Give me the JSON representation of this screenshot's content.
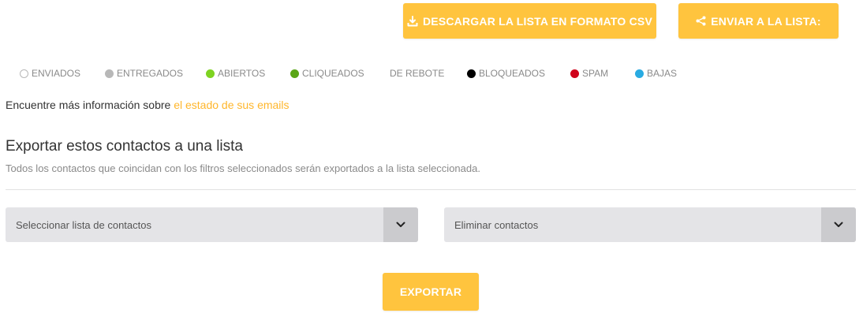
{
  "actions": {
    "download_csv_label": "DESCARGAR LA LISTA EN FORMATO CSV",
    "send_to_list_label": "ENVIAR A LA LISTA:"
  },
  "legend": [
    {
      "label": "ENVIADOS",
      "color": "#ffffff",
      "outline": true
    },
    {
      "label": "ENTREGADOS",
      "color": "#b8b8b8"
    },
    {
      "label": "ABIERTOS",
      "color": "#7ed321"
    },
    {
      "label": "CLIQUEADOS",
      "color": "#5aa617"
    },
    {
      "label": "DE REBOTE",
      "color": null
    },
    {
      "label": "BLOQUEADOS",
      "color": "#000000"
    },
    {
      "label": "SPAM",
      "color": "#d0021b"
    },
    {
      "label": "BAJAS",
      "color": "#29abe2"
    }
  ],
  "info": {
    "prefix": "Encuentre más información sobre ",
    "link": "el estado de sus emails"
  },
  "export": {
    "title": "Exportar estos contactos a una lista",
    "subtitle": "Todos los contactos que coincidan con los filtros seleccionados serán exportados a la lista seleccionada.",
    "select_list_value": "Seleccionar lista de contactos",
    "action_select_value": "Eliminar contactos",
    "button_label": "EXPORTAR"
  },
  "colors": {
    "accent": "#ffc43e",
    "link": "#ffb62b",
    "select_bg": "#e4e4e7"
  }
}
